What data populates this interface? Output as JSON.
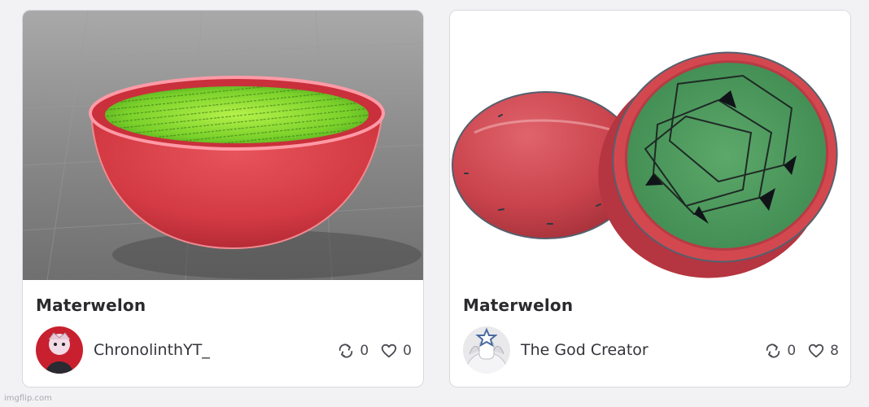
{
  "cards": [
    {
      "title": "Materwelon",
      "creator": "ChronolinthYT_",
      "remix_count": "0",
      "like_count": "0",
      "icons": {
        "remix": "remix-icon",
        "like": "heart-icon"
      }
    },
    {
      "title": "Materwelon",
      "creator": "The God Creator",
      "remix_count": "0",
      "like_count": "8",
      "icons": {
        "remix": "remix-icon",
        "like": "heart-icon"
      }
    }
  ],
  "watermark": "imgflip.com",
  "colors": {
    "card_border": "#d9d9de",
    "background": "#f2f2f4",
    "melon_red": "#d8464e",
    "melon_green": "#4c9a5a",
    "glow_green": "#8fe23a"
  }
}
